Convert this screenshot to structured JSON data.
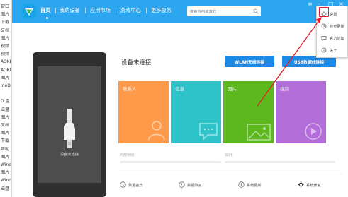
{
  "background_window": {
    "rows": [
      "窗口",
      "图片",
      "下载",
      "文档",
      "图片",
      "视频",
      "视频",
      "AOKI",
      "AOKI",
      "图片",
      "ineOr",
      "",
      "D 盘",
      "磁盘",
      "图片",
      "文档",
      "图片",
      "下载",
      "帮助",
      "图片",
      "Wind",
      "图片",
      "Wind",
      "磁盘"
    ]
  },
  "app": {
    "nav": {
      "home": "首页",
      "my_device": "我的设备",
      "app_market": "应用市场",
      "game_center": "游戏中心",
      "more_services": "更多服务"
    },
    "search": {
      "placeholder": "搜索应用或游戏"
    },
    "window_controls": {
      "menu": "≡",
      "minimize": "–",
      "maximize": "□",
      "close": "×"
    },
    "menu": {
      "items": [
        {
          "label": "设置",
          "icon": "gear-icon"
        },
        {
          "label": "检查更新",
          "icon": "refresh-icon"
        },
        {
          "label": "官方论坛",
          "icon": "forum-icon"
        },
        {
          "label": "关于",
          "icon": "info-icon"
        }
      ]
    },
    "phone": {
      "caption": "设备未连接"
    },
    "status_title": "设备未连接",
    "buttons": {
      "wlan": "WLAN无线连接",
      "usb": "USB数据线连接"
    },
    "tiles": [
      {
        "label": "联系人",
        "color": "#ff9a4a"
      },
      {
        "label": "信息",
        "color": "#2dc3c9"
      },
      {
        "label": "图片",
        "color": "#5cb81c"
      },
      {
        "label": "视频",
        "color": "#b36ed9"
      }
    ],
    "storage": {
      "internal": "内部存储",
      "sd": "SD卡"
    },
    "bottom": {
      "backup": "数据备份",
      "restore": "数据恢复",
      "update": "系统更新",
      "repair": "系统修复"
    }
  }
}
